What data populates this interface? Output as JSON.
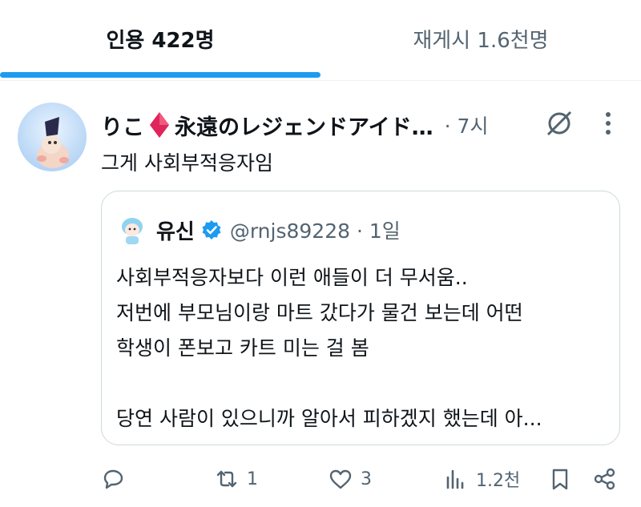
{
  "tabs": {
    "quotes_label": "인용 422명",
    "reposts_label": "재게시 1.6천명"
  },
  "tweet": {
    "display_name_prefix": "りこ",
    "display_name_suffix": "永遠のレジェンドアイド…",
    "time": "· 7시",
    "text": "그게 사회부적응자임"
  },
  "quoted": {
    "name": "유신",
    "handle": "@rnjs89228 · 1일",
    "body": "사회부적응자보다 이런 애들이 더 무서움..\n저번에 부모님이랑 마트 갔다가 물건 보는데 어떤\n학생이 폰보고 카트 미는 걸 봄\n\n당연 사람이 있으니까 알아서 피하겠지 했는데 아..."
  },
  "actions": {
    "reply_count": "",
    "repost_count": "1",
    "like_count": "3",
    "views_count": "1.2천"
  },
  "colors": {
    "accent": "#1d9bf0",
    "secondary_text": "#536471",
    "border": "#cfd9de",
    "diamond": "#e0245e"
  },
  "icons": [
    "diamond-icon",
    "grok-icon",
    "more-icon",
    "verified-badge-icon",
    "reply-icon",
    "repost-icon",
    "like-icon",
    "views-icon",
    "bookmark-icon",
    "share-icon"
  ]
}
